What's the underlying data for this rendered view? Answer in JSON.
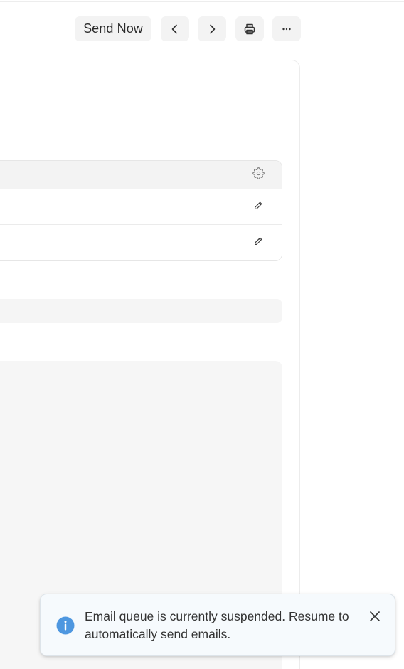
{
  "toolbar": {
    "send_now_label": "Send Now",
    "prev_icon": "chevron-left-icon",
    "next_icon": "chevron-right-icon",
    "print_icon": "printer-icon",
    "more_icon": "more-horizontal-icon"
  },
  "grid": {
    "settings_icon": "gear-icon",
    "rows": [
      {
        "edit_icon": "pencil-icon"
      },
      {
        "edit_icon": "pencil-icon"
      }
    ]
  },
  "toast": {
    "message": "Email queue is currently suspended. Resume to automatically send emails.",
    "icon": "info-icon",
    "close_icon": "close-icon",
    "accent_color": "#4e97e0"
  }
}
